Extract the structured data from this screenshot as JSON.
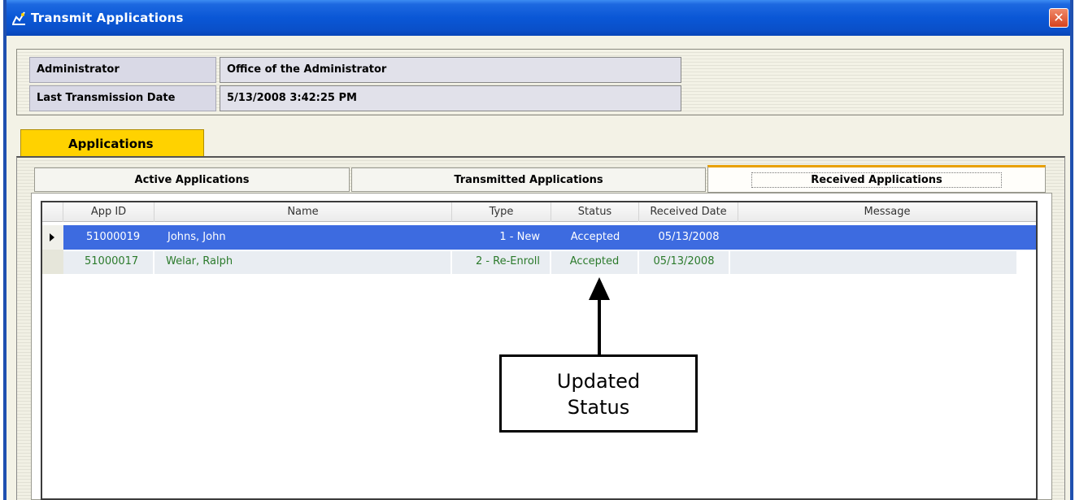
{
  "window": {
    "title": "Transmit Applications",
    "close_label": "✕"
  },
  "info": {
    "administrator_label": "Administrator",
    "administrator_value": "Office of the Administrator",
    "last_transmission_label": "Last Transmission Date",
    "last_transmission_value": "5/13/2008 3:42:25 PM"
  },
  "outer_tabs": [
    {
      "label": "Applications"
    }
  ],
  "inner_tabs": [
    {
      "label": "Active Applications"
    },
    {
      "label": "Transmitted Applications"
    },
    {
      "label": "Received Applications",
      "active": true
    }
  ],
  "grid": {
    "columns": [
      "App ID",
      "Name",
      "Type",
      "Status",
      "Received Date",
      "Message"
    ],
    "rows": [
      {
        "app_id": "51000019",
        "name": "Johns, John",
        "type": "1 - New",
        "status": "Accepted",
        "received_date": "05/13/2008",
        "message": "",
        "selected": true
      },
      {
        "app_id": "51000017",
        "name": "Welar, Ralph",
        "type": "2 - Re-Enroll",
        "status": "Accepted",
        "received_date": "05/13/2008",
        "message": "",
        "selected": false
      }
    ]
  },
  "annotation": {
    "line1": "Updated",
    "line2": "Status"
  },
  "colors": {
    "titlebar": "#0a57d6",
    "tab_active": "#ffd200",
    "selected_row": "#3d6be0",
    "row_text": "#2b7a2b"
  }
}
